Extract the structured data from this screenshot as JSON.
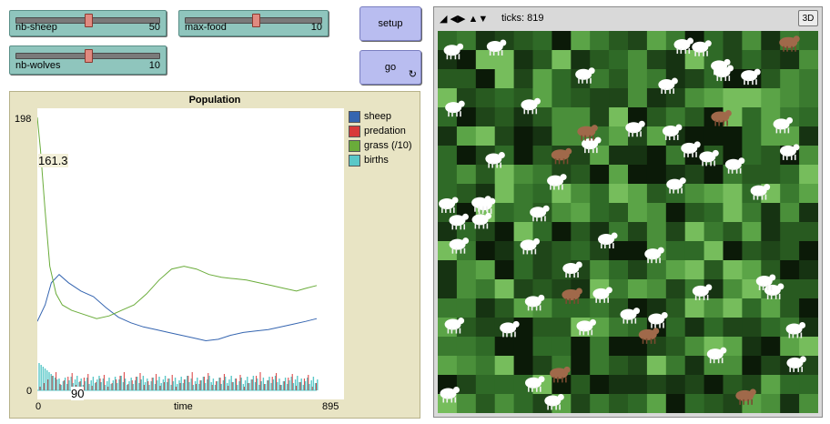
{
  "sliders": [
    {
      "label": "nb-sheep",
      "value": "50",
      "fraction": 0.5
    },
    {
      "label": "max-food",
      "value": "10",
      "fraction": 0.5
    },
    {
      "label": "nb-wolves",
      "value": "10",
      "fraction": 0.5
    }
  ],
  "buttons": {
    "setup": "setup",
    "go": "go",
    "go_forever_icon": "forever-icon"
  },
  "plot": {
    "title": "Population",
    "y_max_label": "198",
    "y_min_label": "0",
    "x_min_label": "0",
    "x_max_label": "895",
    "x_axis_label": "time",
    "hover_value": "161.3",
    "hover_value2": "90"
  },
  "legend": [
    {
      "name": "sheep",
      "color": "#3565b0"
    },
    {
      "name": "predation",
      "color": "#d83a3a"
    },
    {
      "name": "grass (/10)",
      "color": "#6aac3a"
    },
    {
      "name": "births",
      "color": "#5ac8c8"
    }
  ],
  "chart_data": {
    "type": "line",
    "title": "Population",
    "xlabel": "time",
    "ylabel": "",
    "xlim": [
      0,
      895
    ],
    "ylim": [
      0,
      198
    ],
    "series": [
      {
        "name": "sheep",
        "x": [
          0,
          25,
          45,
          70,
          100,
          140,
          180,
          220,
          260,
          300,
          340,
          380,
          420,
          460,
          500,
          540,
          580,
          620,
          660,
          700,
          740,
          780,
          820,
          860,
          895
        ],
        "values": [
          50,
          62,
          78,
          84,
          78,
          72,
          68,
          60,
          53,
          49,
          46,
          44,
          42,
          40,
          38,
          36,
          37,
          40,
          42,
          43,
          44,
          46,
          48,
          50,
          52
        ]
      },
      {
        "name": "grass (/10)",
        "x": [
          0,
          10,
          25,
          40,
          60,
          80,
          110,
          150,
          190,
          230,
          270,
          310,
          350,
          390,
          430,
          470,
          510,
          550,
          590,
          630,
          670,
          710,
          750,
          790,
          830,
          860,
          895
        ],
        "values": [
          198,
          175,
          130,
          90,
          70,
          62,
          58,
          55,
          52,
          54,
          58,
          62,
          70,
          80,
          88,
          90,
          88,
          84,
          82,
          81,
          80,
          78,
          76,
          74,
          72,
          74,
          76
        ]
      },
      {
        "name": "predation",
        "x": [
          0,
          895
        ],
        "values": [
          0,
          0
        ]
      },
      {
        "name": "births",
        "x": [
          0,
          895
        ],
        "values": [
          0,
          0
        ]
      }
    ]
  },
  "view": {
    "ticks_label": "ticks: 819",
    "three_d_label": "3D"
  }
}
